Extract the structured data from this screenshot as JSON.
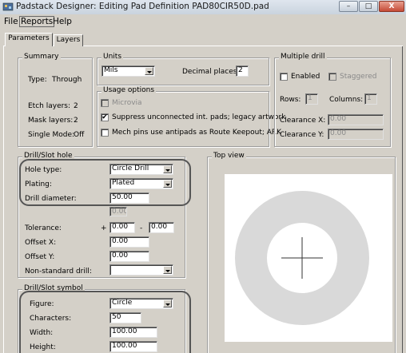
{
  "window": {
    "title": "Padstack Designer: Editing Pad Definition PAD80CIR50D.pad",
    "minimize": "–",
    "maximize": "□",
    "close": "X"
  },
  "menu": [
    "File",
    "Reports",
    "Help"
  ],
  "tabs": [
    "Parameters",
    "Layers"
  ],
  "summary": {
    "legend": "Summary",
    "type_label": "Type:",
    "type_value": "Through",
    "etch_label": "Etch layers:",
    "etch_value": "2",
    "mask_label": "Mask layers:",
    "mask_value": "2",
    "single_label": "Single Mode:",
    "single_value": "Off"
  },
  "units": {
    "legend": "Units",
    "selected": "Mils",
    "decimal_label": "Decimal places:",
    "decimal_value": "2"
  },
  "usage": {
    "legend": "Usage options",
    "microvia": "Microvia",
    "suppress": "Suppress unconnected int. pads; legacy artwork",
    "suppress_checked": "✔",
    "mech": "Mech pins use antipads as Route Keepout; ARK"
  },
  "multiple_drill": {
    "legend": "Multiple drill",
    "enabled": "Enabled",
    "staggered": "Staggered",
    "rows_label": "Rows:",
    "rows_value": "1",
    "cols_label": "Columns:",
    "cols_value": "1",
    "clearance_x_label": "Clearance X:",
    "clearance_x_value": "0.00",
    "clearance_y_label": "Clearance Y:",
    "clearance_y_value": "0.00"
  },
  "drill_hole": {
    "legend": "Drill/Slot hole",
    "hole_type_label": "Hole type:",
    "hole_type_value": "Circle Drill",
    "plating_label": "Plating:",
    "plating_value": "Plated",
    "diameter_label": "Drill diameter:",
    "diameter_value": "50.00",
    "extra_value": "0.00",
    "tolerance_label": "Tolerance:",
    "tol_plus": "+",
    "tol_plus_value": "0.00",
    "tol_minus": "-",
    "tol_minus_value": "0.00",
    "offset_x_label": "Offset X:",
    "offset_x_value": "0.00",
    "offset_y_label": "Offset Y:",
    "offset_y_value": "0.00",
    "nonstd_label": "Non-standard drill:",
    "nonstd_value": ""
  },
  "drill_symbol": {
    "legend": "Drill/Slot symbol",
    "figure_label": "Figure:",
    "figure_value": "Circle",
    "characters_label": "Characters:",
    "characters_value": "50",
    "width_label": "Width:",
    "width_value": "100.00",
    "height_label": "Height:",
    "height_value": "100.00"
  },
  "top_view": {
    "legend": "Top view"
  },
  "colors": {
    "pad_ring": "#d9d9d9",
    "drill_circle": "#ffffff",
    "crosshair": "#333333"
  }
}
